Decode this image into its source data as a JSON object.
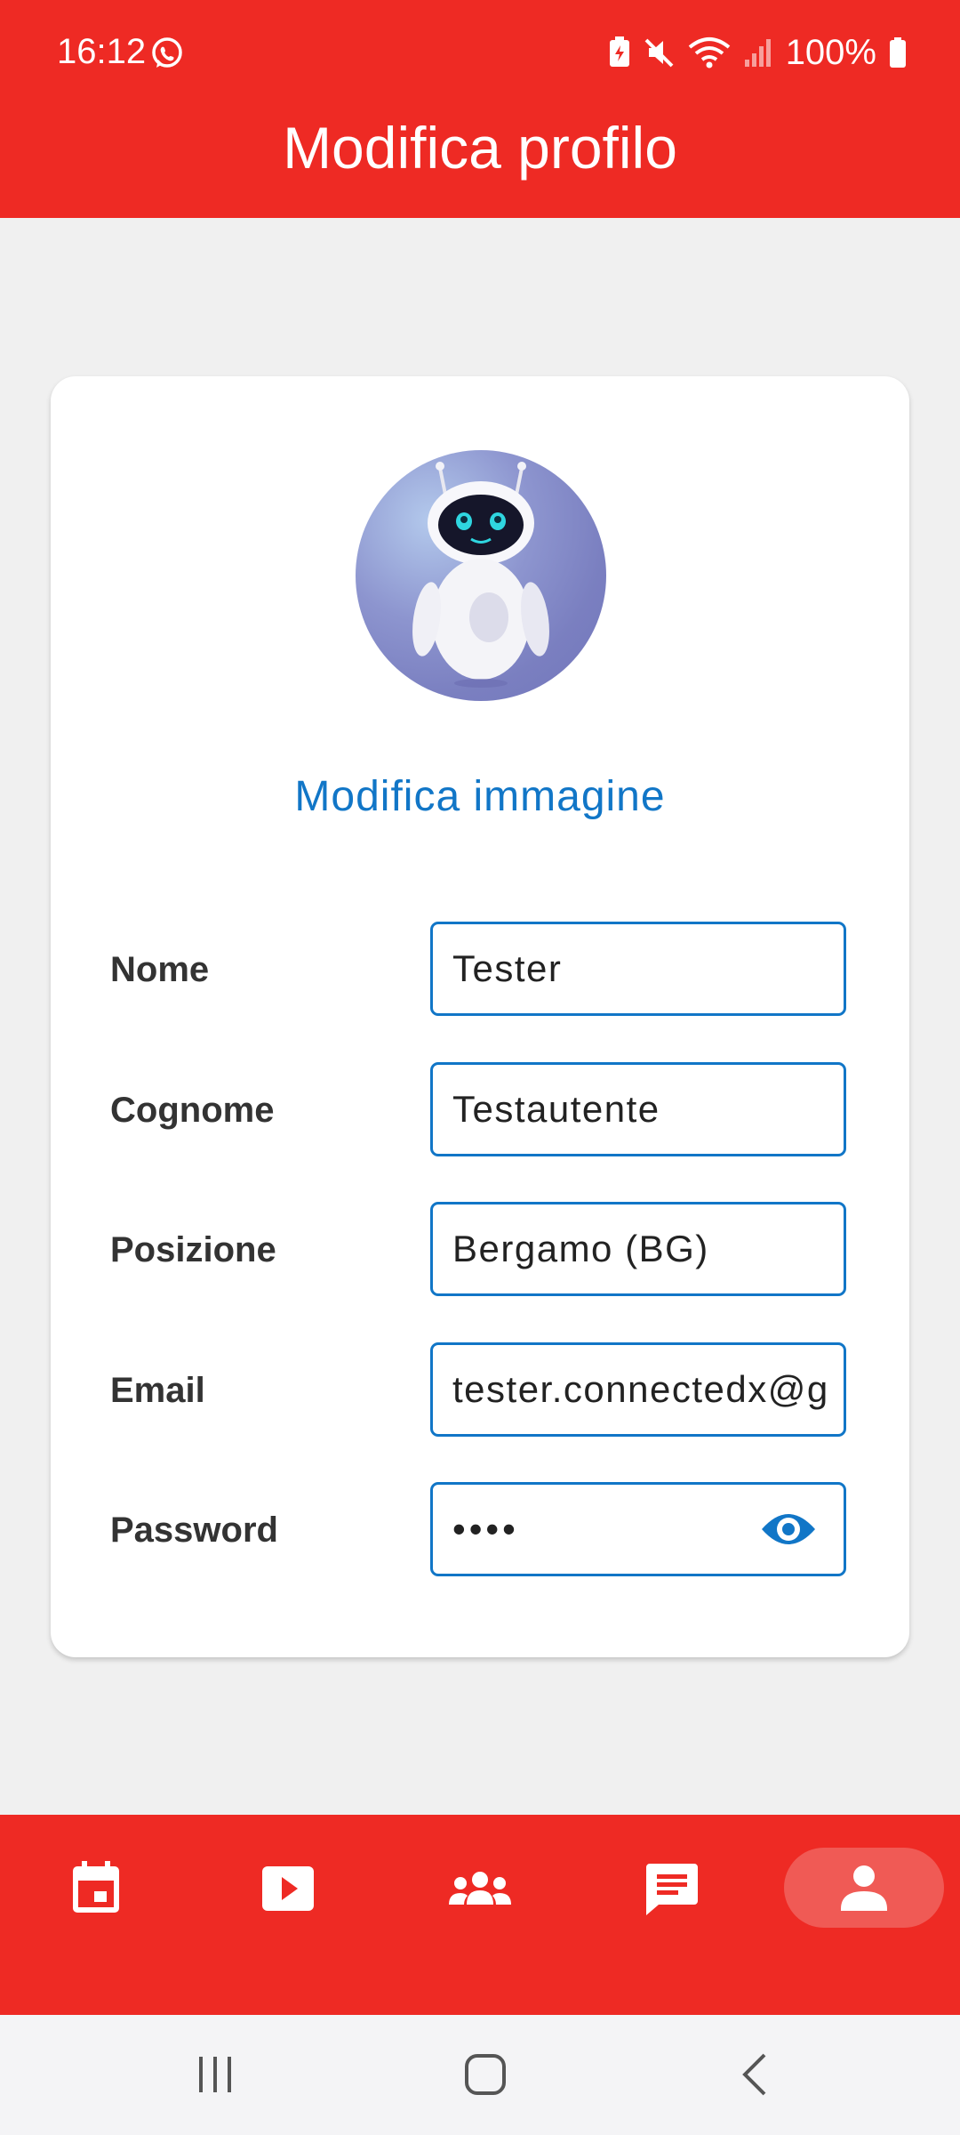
{
  "status_bar": {
    "time": "16:12",
    "battery": "100%",
    "icons": [
      "whatsapp-icon",
      "battery-saver-icon",
      "mute-icon",
      "wifi-icon",
      "signal-icon",
      "battery-icon"
    ]
  },
  "header": {
    "title": "Modifica profilo"
  },
  "profile": {
    "avatar": "robot-avatar",
    "edit_image_label": "Modifica immagine"
  },
  "form": {
    "fields": [
      {
        "label": "Nome",
        "value": "Tester"
      },
      {
        "label": "Cognome",
        "value": "Testautente"
      },
      {
        "label": "Posizione",
        "value": "Bergamo (BG)"
      },
      {
        "label": "Email",
        "value": "tester.connectedx@g"
      },
      {
        "label": "Password",
        "value": "••••"
      }
    ]
  },
  "bottom_nav": {
    "items": [
      {
        "icon": "calendar-icon",
        "active": false
      },
      {
        "icon": "play-video-icon",
        "active": false
      },
      {
        "icon": "group-icon",
        "active": false
      },
      {
        "icon": "chat-icon",
        "active": false
      },
      {
        "icon": "person-icon",
        "active": true
      }
    ]
  },
  "system_nav": {
    "icons": [
      "recents-icon",
      "home-icon",
      "back-icon"
    ]
  },
  "colors": {
    "primary_red": "#ee2a24",
    "accent_blue": "#1176c7",
    "background": "#f0f0f0",
    "active_pill": "#f05a55"
  }
}
